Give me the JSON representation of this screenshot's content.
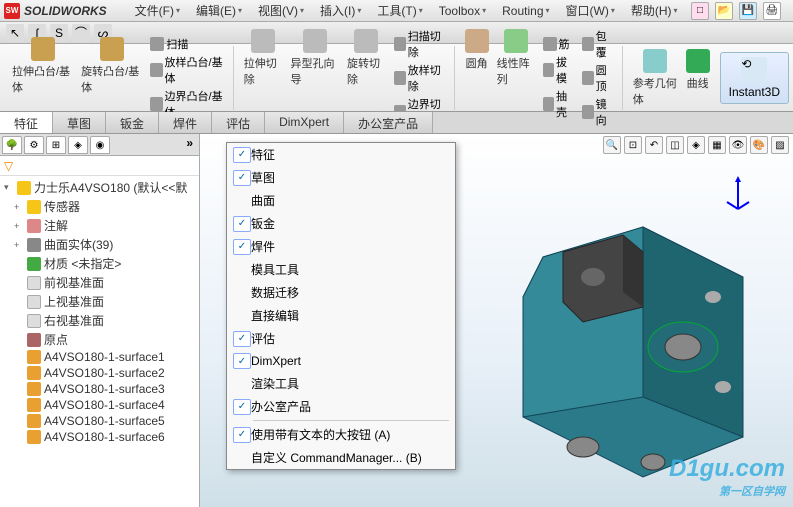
{
  "app": {
    "title": "SOLIDWORKS"
  },
  "menus": [
    {
      "label": "文件(F)"
    },
    {
      "label": "编辑(E)"
    },
    {
      "label": "视图(V)"
    },
    {
      "label": "插入(I)"
    },
    {
      "label": "工具(T)"
    },
    {
      "label": "Toolbox"
    },
    {
      "label": "Routing"
    },
    {
      "label": "窗口(W)"
    },
    {
      "label": "帮助(H)"
    }
  ],
  "ribbon": {
    "boss": {
      "extrude": "拉伸凸台/基体",
      "revolve": "旋转凸台/基体",
      "sweep": "扫描",
      "loft": "放样凸台/基体",
      "boundary": "边界凸台/基体"
    },
    "cut": {
      "extrude": "拉伸切除",
      "hole": "异型孔向导",
      "revolve": "旋转切除",
      "sweep": "扫描切除",
      "loft": "放样切除",
      "boundary": "边界切除"
    },
    "feat": {
      "fillet": "圆角",
      "pattern": "线性阵列",
      "rib": "筋",
      "draft": "拔模",
      "shell": "抽壳",
      "wrap": "包覆",
      "dome": "圆顶",
      "mirror": "镜向"
    },
    "ref": {
      "geom": "参考几何体",
      "curve": "曲线",
      "instant3d": "Instant3D"
    }
  },
  "tabs": [
    {
      "label": "特征",
      "active": true
    },
    {
      "label": "草图"
    },
    {
      "label": "钣金"
    },
    {
      "label": "焊件"
    },
    {
      "label": "评估"
    },
    {
      "label": "DimXpert"
    },
    {
      "label": "办公室产品"
    }
  ],
  "tree": {
    "root": "力士乐A4VSO180   (默认<<默",
    "items": [
      {
        "label": "传感器",
        "icon": "folder",
        "exp": "+"
      },
      {
        "label": "注解",
        "icon": "note",
        "exp": "+"
      },
      {
        "label": "曲面实体(39)",
        "icon": "body",
        "exp": "+"
      },
      {
        "label": "材质 <未指定>",
        "icon": "mat",
        "exp": ""
      },
      {
        "label": "前视基准面",
        "icon": "plane",
        "exp": ""
      },
      {
        "label": "上视基准面",
        "icon": "plane",
        "exp": ""
      },
      {
        "label": "右视基准面",
        "icon": "plane",
        "exp": ""
      },
      {
        "label": "原点",
        "icon": "origin",
        "exp": ""
      },
      {
        "label": "A4VSO180-1-surface1",
        "icon": "surf",
        "exp": ""
      },
      {
        "label": "A4VSO180-1-surface2",
        "icon": "surf",
        "exp": ""
      },
      {
        "label": "A4VSO180-1-surface3",
        "icon": "surf",
        "exp": ""
      },
      {
        "label": "A4VSO180-1-surface4",
        "icon": "surf",
        "exp": ""
      },
      {
        "label": "A4VSO180-1-surface5",
        "icon": "surf",
        "exp": ""
      },
      {
        "label": "A4VSO180-1-surface6",
        "icon": "surf",
        "exp": ""
      }
    ]
  },
  "context_menu": {
    "sections": [
      [
        {
          "label": "特征",
          "checked": true
        },
        {
          "label": "草图",
          "checked": true
        },
        {
          "label": "曲面",
          "checked": false
        },
        {
          "label": "钣金",
          "checked": true
        },
        {
          "label": "焊件",
          "checked": true
        },
        {
          "label": "模具工具",
          "checked": false
        },
        {
          "label": "数据迁移",
          "checked": false
        },
        {
          "label": "直接编辑",
          "checked": false
        },
        {
          "label": "评估",
          "checked": true
        },
        {
          "label": "DimXpert",
          "checked": true
        },
        {
          "label": "渲染工具",
          "checked": false
        },
        {
          "label": "办公室产品",
          "checked": true
        }
      ],
      [
        {
          "label": "使用带有文本的大按钮 (A)",
          "checked": true
        },
        {
          "label": "自定义 CommandManager... (B)",
          "checked": false
        }
      ]
    ]
  },
  "watermark": {
    "main": "D1gu.com",
    "sub": "第一区自学网"
  }
}
